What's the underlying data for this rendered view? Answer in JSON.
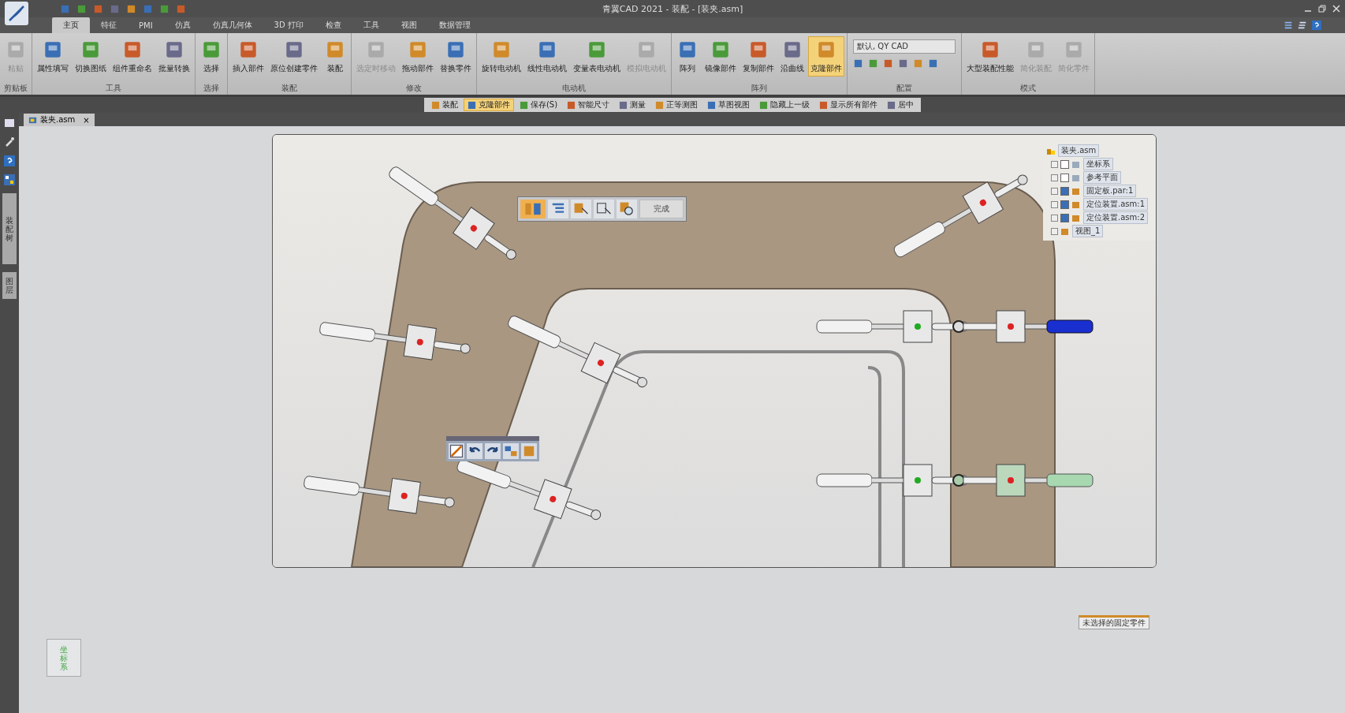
{
  "window": {
    "title": "青翼CAD 2021 - 装配 - [装夹.asm]"
  },
  "tabs": [
    {
      "label": "主页",
      "selected": true
    },
    {
      "label": "特征",
      "selected": false
    },
    {
      "label": "PMI",
      "selected": false
    },
    {
      "label": "仿真",
      "selected": false
    },
    {
      "label": "仿真几何体",
      "selected": false
    },
    {
      "label": "3D 打印",
      "selected": false
    },
    {
      "label": "检查",
      "selected": false
    },
    {
      "label": "工具",
      "selected": false
    },
    {
      "label": "视图",
      "selected": false
    },
    {
      "label": "数据管理",
      "selected": false
    }
  ],
  "ribbon": [
    {
      "group": "剪贴板",
      "buttons": [
        {
          "label": "粘贴",
          "disabled": true,
          "selected": false
        }
      ]
    },
    {
      "group": "工具",
      "buttons": [
        {
          "label": "属性填写",
          "disabled": false,
          "selected": false
        },
        {
          "label": "切换图纸",
          "disabled": false,
          "selected": false
        },
        {
          "label": "组件重命名",
          "disabled": false,
          "selected": false
        },
        {
          "label": "批量转换",
          "disabled": false,
          "selected": false
        }
      ]
    },
    {
      "group": "选择",
      "buttons": [
        {
          "label": "选择",
          "disabled": false,
          "selected": false
        }
      ]
    },
    {
      "group": "装配",
      "buttons": [
        {
          "label": "插入部件",
          "disabled": false,
          "selected": false
        },
        {
          "label": "原位创建零件",
          "disabled": false,
          "selected": false
        },
        {
          "label": "装配",
          "disabled": false,
          "selected": false
        }
      ]
    },
    {
      "group": "修改",
      "buttons": [
        {
          "label": "选定时移动",
          "disabled": true,
          "selected": false
        },
        {
          "label": "拖动部件",
          "disabled": false,
          "selected": false
        },
        {
          "label": "替换零件",
          "disabled": false,
          "selected": false
        }
      ]
    },
    {
      "group": "电动机",
      "buttons": [
        {
          "label": "旋转电动机",
          "disabled": false,
          "selected": false
        },
        {
          "label": "线性电动机",
          "disabled": false,
          "selected": false
        },
        {
          "label": "变量表电动机",
          "disabled": false,
          "selected": false
        },
        {
          "label": "模拟电动机",
          "disabled": true,
          "selected": false
        }
      ]
    },
    {
      "group": "阵列",
      "buttons": [
        {
          "label": "阵列",
          "disabled": false,
          "selected": false
        },
        {
          "label": "镜像部件",
          "disabled": false,
          "selected": false
        },
        {
          "label": "复制部件",
          "disabled": false,
          "selected": false
        },
        {
          "label": "沿曲线",
          "disabled": false,
          "selected": false
        },
        {
          "label": "克隆部件",
          "disabled": false,
          "selected": true
        }
      ]
    },
    {
      "group": "配置",
      "dropdown": "默认, QY CAD"
    },
    {
      "group": "模式",
      "buttons": [
        {
          "label": "大型装配性能",
          "disabled": false,
          "selected": false
        },
        {
          "label": "简化装配",
          "disabled": true,
          "selected": false
        },
        {
          "label": "简化零件",
          "disabled": true,
          "selected": false
        }
      ]
    }
  ],
  "command_bar": [
    {
      "label": "装配",
      "selected": false
    },
    {
      "label": "克隆部件",
      "selected": true
    },
    {
      "label": "保存(S)",
      "selected": false
    },
    {
      "label": "智能尺寸",
      "selected": false
    },
    {
      "label": "测量",
      "selected": false
    },
    {
      "label": "正等测图",
      "selected": false
    },
    {
      "label": "草图视图",
      "selected": false
    },
    {
      "label": "隐藏上一级",
      "selected": false
    },
    {
      "label": "显示所有部件",
      "selected": false
    },
    {
      "label": "居中",
      "selected": false
    }
  ],
  "document_tab": {
    "label": "装夹.asm",
    "close": "×"
  },
  "side_panel": [
    {
      "label": "装配树"
    },
    {
      "label": "图层"
    }
  ],
  "clone_toolbar": {
    "done": "完成"
  },
  "tree": {
    "root": "装夹.asm",
    "children": [
      {
        "kind": "checkbox",
        "label": "坐标系",
        "checked": false
      },
      {
        "kind": "checkbox",
        "label": "参考平面",
        "checked": false
      },
      {
        "kind": "checkbox",
        "label": "固定板.par:1",
        "checked": true
      },
      {
        "kind": "checkbox",
        "label": "定位装置.asm:1",
        "checked": true
      },
      {
        "kind": "checkbox",
        "label": "定位装置.asm:2",
        "checked": true
      },
      {
        "kind": "plain",
        "label": "视图_1"
      }
    ]
  },
  "status_label": "未选择的固定零件",
  "triad_label": "坐标系"
}
